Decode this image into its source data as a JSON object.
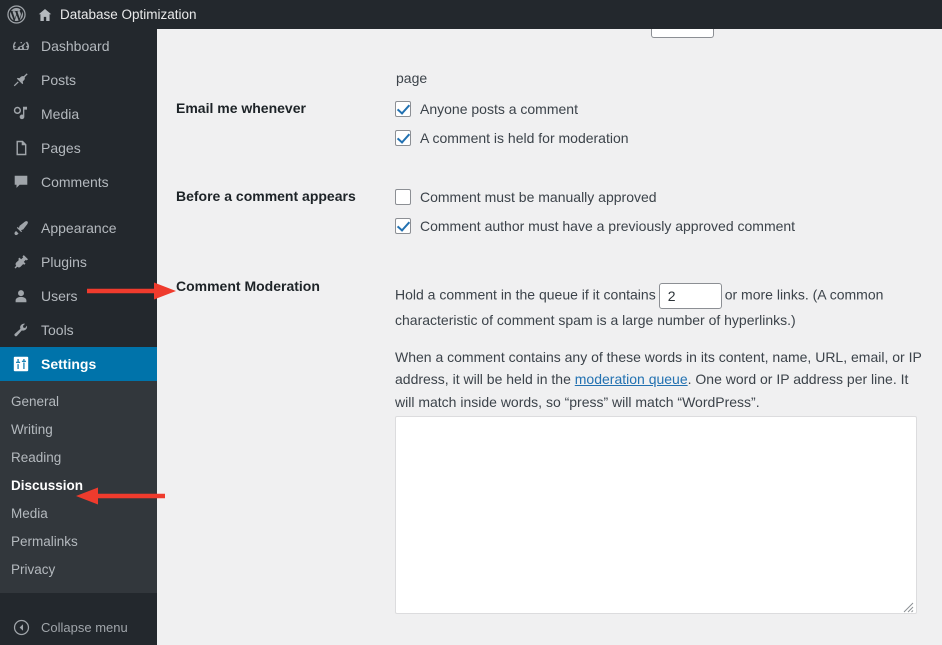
{
  "adminbar": {
    "wp_logo_icon": "wordpress-logo-icon",
    "home_icon": "home-icon",
    "site_title": "Database Optimization"
  },
  "sidebar": {
    "items": [
      {
        "label": "Dashboard",
        "icon": "dashboard-icon",
        "current": false
      },
      {
        "label": "Posts",
        "icon": "pin-icon",
        "current": false
      },
      {
        "label": "Media",
        "icon": "media-icon",
        "current": false
      },
      {
        "label": "Pages",
        "icon": "pages-icon",
        "current": false
      },
      {
        "label": "Comments",
        "icon": "comment-bubble-icon",
        "current": false
      },
      {
        "label": "Appearance",
        "icon": "paintbrush-icon",
        "current": false
      },
      {
        "label": "Plugins",
        "icon": "plug-icon",
        "current": false
      },
      {
        "label": "Users",
        "icon": "user-icon",
        "current": false
      },
      {
        "label": "Tools",
        "icon": "wrench-icon",
        "current": false
      },
      {
        "label": "Settings",
        "icon": "settings-sliders-icon",
        "current": true
      }
    ],
    "submenu": [
      {
        "label": "General",
        "current": false
      },
      {
        "label": "Writing",
        "current": false
      },
      {
        "label": "Reading",
        "current": false
      },
      {
        "label": "Discussion",
        "current": true
      },
      {
        "label": "Media",
        "current": false
      },
      {
        "label": "Permalinks",
        "current": false
      },
      {
        "label": "Privacy",
        "current": false
      }
    ],
    "collapse_label": "Collapse menu",
    "collapse_icon": "collapse-arrow-icon"
  },
  "main": {
    "orphan_text": "page",
    "rows": [
      {
        "label": "Email me whenever",
        "checkboxes": [
          {
            "label": "Anyone posts a comment",
            "checked": true
          },
          {
            "label": "A comment is held for moderation",
            "checked": true
          }
        ]
      },
      {
        "label": "Before a comment appears",
        "checkboxes": [
          {
            "label": "Comment must be manually approved",
            "checked": false
          },
          {
            "label": "Comment author must have a previously approved comment",
            "checked": true
          }
        ]
      }
    ],
    "moderation": {
      "label": "Comment Moderation",
      "hold_text_before": "Hold a comment in the queue if it contains",
      "links_value": "2",
      "hold_text_after": "or more links. (A common characteristic of comment spam is a large number of hyperlinks.)",
      "keys_text_before": "When a comment contains any of these words in its content, name, URL, email, or IP address, it will be held in the",
      "keys_link": "moderation queue",
      "keys_text_after": ". One word or IP address per line. It will match inside words, so “press” will match “WordPress”.",
      "textarea_value": "",
      "textarea_placeholder": ""
    }
  },
  "colors": {
    "admin_bar_bg": "#23282d",
    "menu_bg": "#23282d",
    "submenu_bg": "#32373c",
    "current_menu_bg": "#0073aa",
    "content_bg": "#f0f0f1",
    "link": "#2271b1",
    "annotation_arrow": "#ef3b2d"
  }
}
